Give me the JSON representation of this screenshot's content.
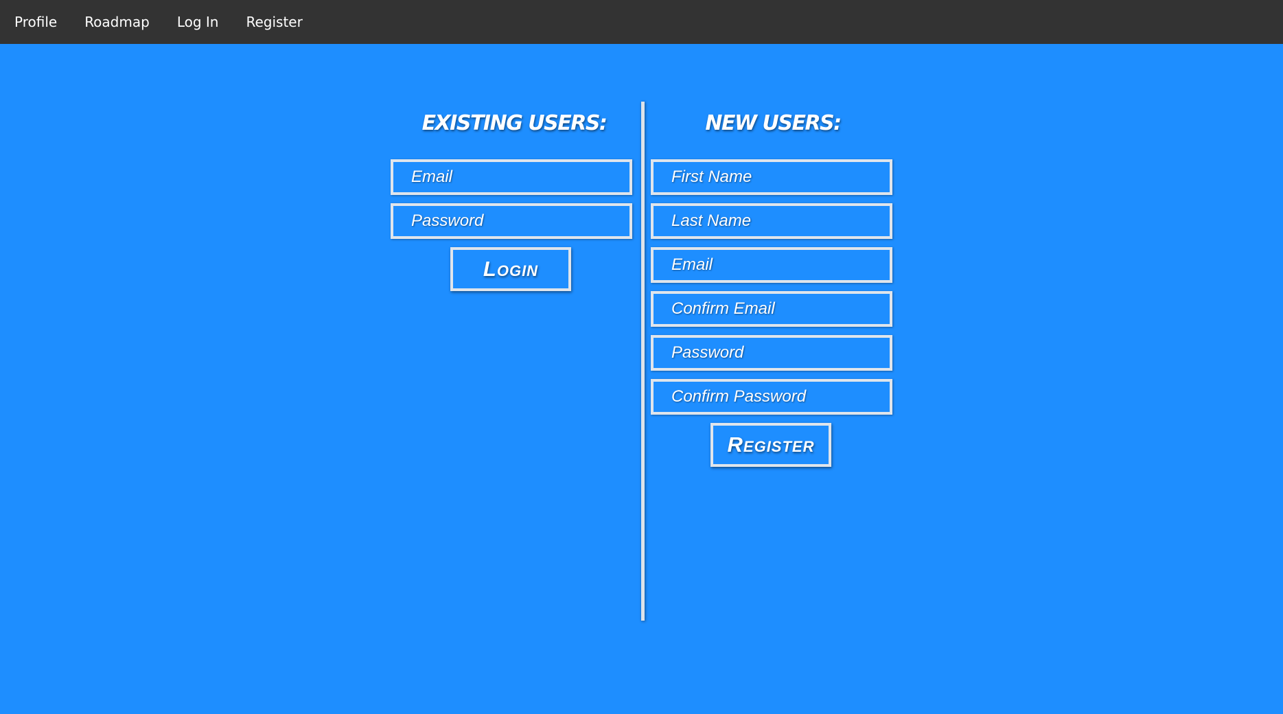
{
  "nav": {
    "items": [
      {
        "label": "Profile"
      },
      {
        "label": "Roadmap"
      },
      {
        "label": "Log In"
      },
      {
        "label": "Register"
      }
    ]
  },
  "login": {
    "heading": "EXISTING USERS:",
    "email_placeholder": "Email",
    "password_placeholder": "Password",
    "button_label": "Login"
  },
  "register": {
    "heading": "NEW USERS:",
    "first_name_placeholder": "First Name",
    "last_name_placeholder": "Last Name",
    "email_placeholder": "Email",
    "confirm_email_placeholder": "Confirm Email",
    "password_placeholder": "Password",
    "confirm_password_placeholder": "Confirm Password",
    "button_label": "Register"
  },
  "colors": {
    "navbar": "#333333",
    "background": "#1e8eff",
    "border": "#dfe5ec",
    "text": "#ffffff"
  }
}
